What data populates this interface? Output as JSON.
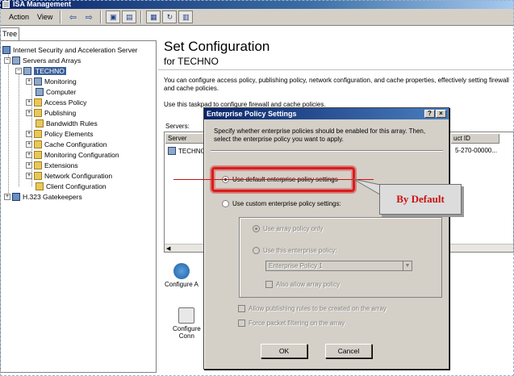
{
  "window": {
    "title": "ISA Management"
  },
  "menu": {
    "action": "Action",
    "view": "View"
  },
  "tree": {
    "tab_label": "Tree",
    "root": "Internet Security and Acceleration Server",
    "servers_and_arrays": "Servers and Arrays",
    "server": "TECHNO",
    "items": [
      "Monitoring",
      "Computer",
      "Access Policy",
      "Publishing",
      "Bandwidth Rules",
      "Policy Elements",
      "Cache Configuration",
      "Monitoring Configuration",
      "Extensions",
      "Network Configuration",
      "Client Configuration"
    ],
    "gatekeepers": "H.323 Gatekeepers"
  },
  "main": {
    "title": "Set Configuration",
    "subtitle": "for TECHNO",
    "description": "You can configure access policy, publishing policy, network configuration, and cache properties, effectively setting firewall and cache policies.",
    "taskpad_text": "Use this taskpad to configure firewall and cache policies.",
    "servers_label": "Servers:",
    "columns": [
      "Server",
      "uct ID"
    ],
    "rows": [
      {
        "server": "TECHNO",
        "product_id": "5-270-00000..."
      }
    ],
    "tasks": [
      "Configure A",
      "Configure",
      "Conn"
    ]
  },
  "dialog": {
    "title": "Enterprise Policy Settings",
    "help_glyph": "?",
    "close_glyph": "×",
    "description": "Specify whether enterprise policies should be enabled for this array. Then, select the enterprise policy you want to apply.",
    "use_default": "Use default enterprise policy settings",
    "use_custom": "Use custom enterprise policy settings:",
    "use_array_only": "Use array policy only",
    "use_this_policy": "Use this enterprise policy:",
    "policy_value": "Enterprise Policy 1",
    "also_allow": "Also allow array policy",
    "allow_publishing": "Allow publishing rules to be created on the array",
    "force_filtering": "Force packet filtering on the array",
    "ok": "OK",
    "cancel": "Cancel",
    "selected_option": "use_default"
  },
  "annotation": {
    "label": "By Default",
    "color": "#cc1111"
  }
}
